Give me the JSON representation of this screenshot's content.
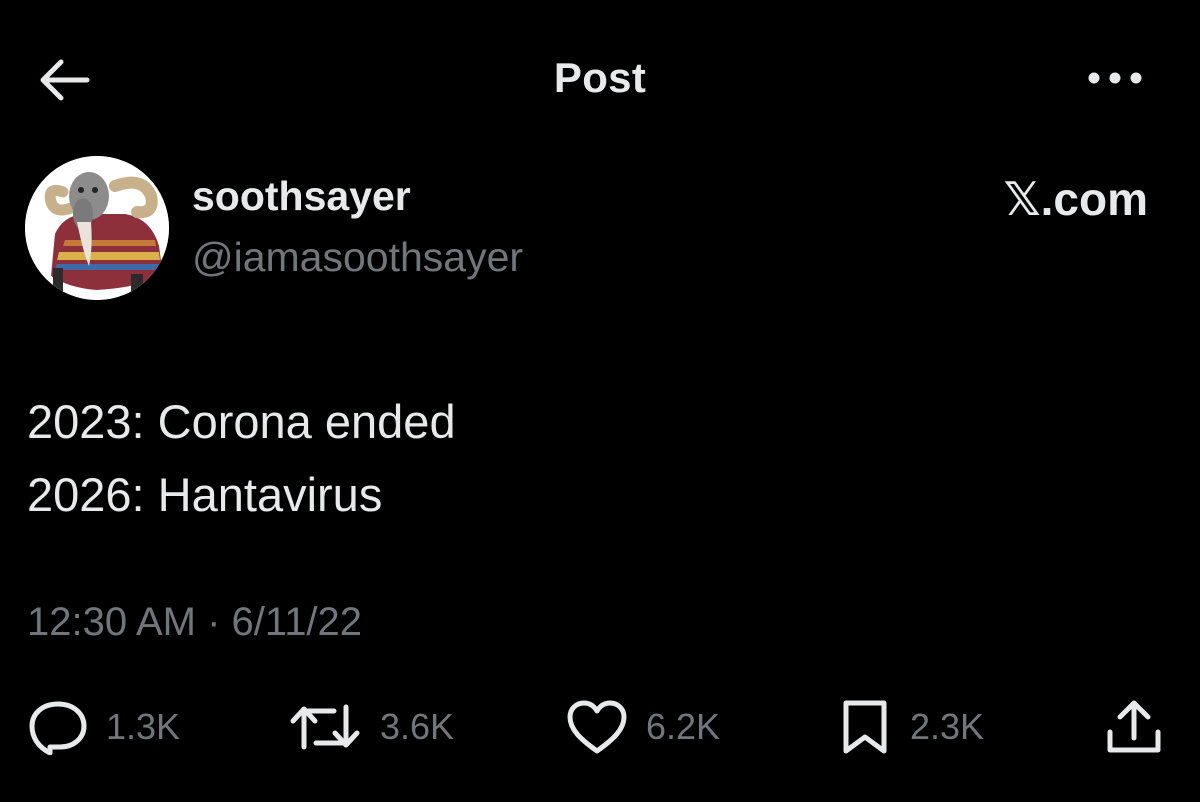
{
  "header": {
    "title": "Post",
    "back_icon": "arrow-left-icon",
    "more_icon": "more-horizontal-icon"
  },
  "author": {
    "display_name": "soothsayer",
    "handle": "@iamasoothsayer",
    "avatar_icon": "goat-soothsayer-avatar"
  },
  "source": {
    "label": "𝕏.com"
  },
  "tweet": {
    "lines": [
      "2023: Corona ended",
      "2026: Hantavirus"
    ]
  },
  "timestamp": {
    "text": "12:30 AM · 6/11/22"
  },
  "actions": {
    "reply": {
      "icon": "reply-icon",
      "count": "1.3K"
    },
    "repost": {
      "icon": "repost-icon",
      "count": "3.6K"
    },
    "like": {
      "icon": "heart-icon",
      "count": "6.2K"
    },
    "bookmark": {
      "icon": "bookmark-icon",
      "count": "2.3K"
    },
    "share": {
      "icon": "share-icon"
    }
  },
  "colors": {
    "background": "#000000",
    "primary_text": "#e7e9ea",
    "secondary_text": "#71767b"
  }
}
